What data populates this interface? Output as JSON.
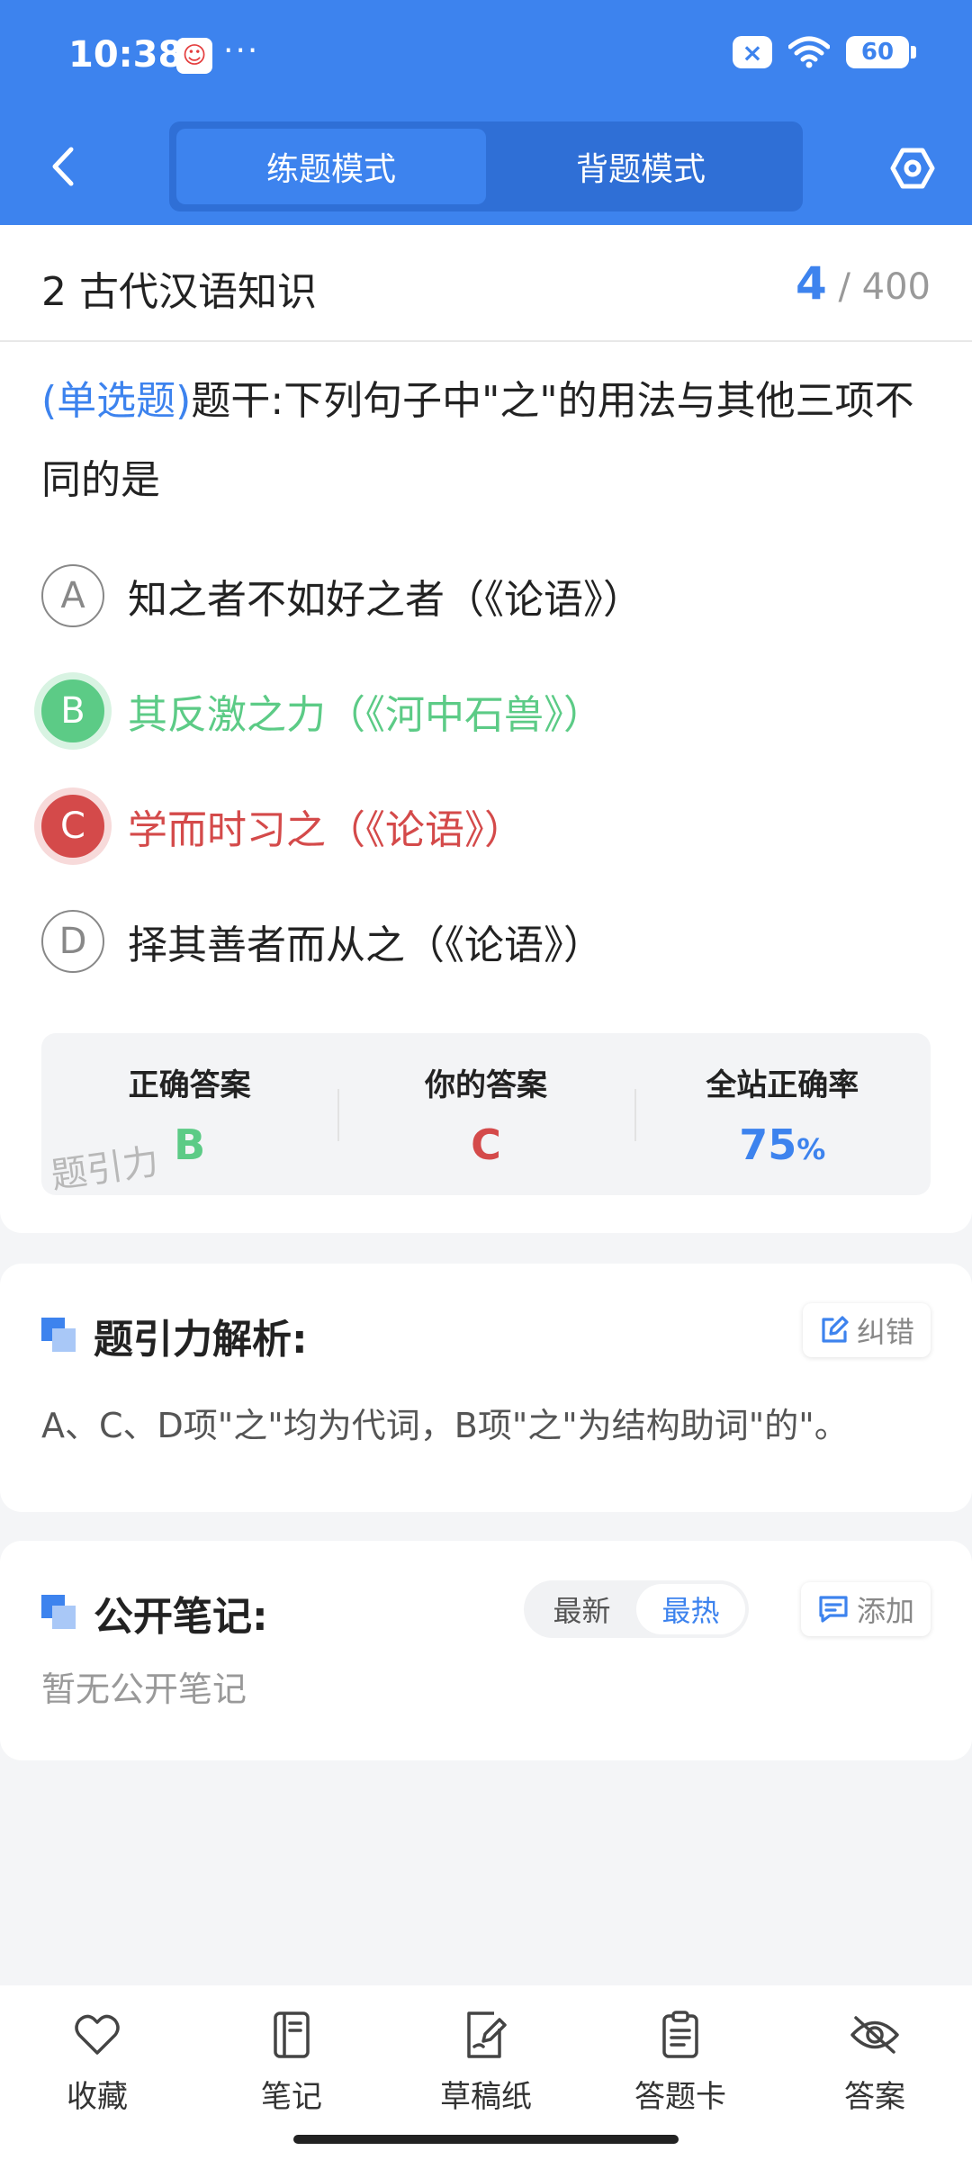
{
  "status_bar": {
    "time": "10:38",
    "dots": "···",
    "battery": "60",
    "x_badge": "×"
  },
  "nav": {
    "modes": [
      "练题模式",
      "背题模式"
    ],
    "active_mode_index": 0
  },
  "question": {
    "chapter": "2 古代汉语知识",
    "current": "4",
    "total": "/ 400",
    "type": "(单选题)",
    "stem": "题干:下列句子中\"之\"的用法与其他三项不同的是",
    "options": [
      {
        "letter": "A",
        "text": "知之者不如好之者（《论语》）",
        "state": "normal"
      },
      {
        "letter": "B",
        "text": "其反激之力（《河中石兽》）",
        "state": "correct"
      },
      {
        "letter": "C",
        "text": "学而时习之（《论语》）",
        "state": "wrong"
      },
      {
        "letter": "D",
        "text": "择其善者而从之（《论语》）",
        "state": "normal"
      }
    ]
  },
  "stats": {
    "correct_label": "正确答案",
    "correct_value": "B",
    "yours_label": "你的答案",
    "yours_value": "C",
    "rate_label": "全站正确率",
    "rate_value": "75",
    "rate_unit": "%",
    "watermark": "题引力"
  },
  "analysis": {
    "title": "题引力解析:",
    "report_label": "纠错",
    "text": "A、C、D项\"之\"均为代词，B项\"之\"为结构助词\"的\"。"
  },
  "notes": {
    "title": "公开笔记:",
    "sort_options": [
      "最新",
      "最热"
    ],
    "active_sort_index": 1,
    "add_label": "添加",
    "empty_text": "暂无公开笔记"
  },
  "bottom_bar": {
    "items": [
      {
        "label": "收藏",
        "icon": "heart-icon"
      },
      {
        "label": "笔记",
        "icon": "notebook-icon"
      },
      {
        "label": "草稿纸",
        "icon": "draft-icon"
      },
      {
        "label": "答题卡",
        "icon": "clipboard-icon"
      },
      {
        "label": "答案",
        "icon": "eye-off-icon"
      }
    ]
  },
  "colors": {
    "primary": "#3d83ee",
    "correct": "#5ccb86",
    "wrong": "#d44a4a"
  }
}
